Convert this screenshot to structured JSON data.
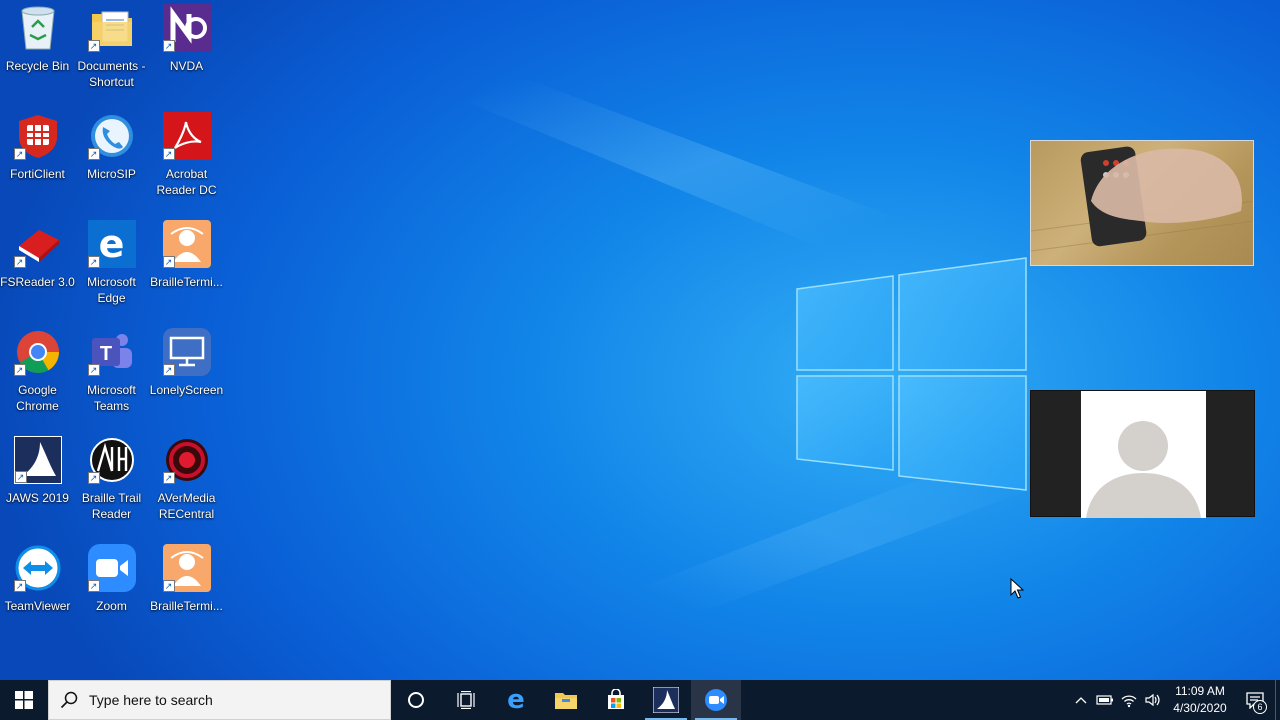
{
  "desktop": {
    "icons": [
      {
        "label": "Recycle Bin"
      },
      {
        "label": "Documents -\nShortcut"
      },
      {
        "label": "NVDA"
      },
      {
        "label": "FortiClient"
      },
      {
        "label": "MicroSIP"
      },
      {
        "label": "Acrobat\nReader DC"
      },
      {
        "label": "FSReader 3.0"
      },
      {
        "label": "Microsoft\nEdge"
      },
      {
        "label": "BrailleTermi..."
      },
      {
        "label": "Google\nChrome"
      },
      {
        "label": "Microsoft\nTeams"
      },
      {
        "label": "LonelyScreen"
      },
      {
        "label": "JAWS 2019"
      },
      {
        "label": "Braille Trail\nReader"
      },
      {
        "label": "AVerMedia\nRECentral"
      },
      {
        "label": "TeamViewer"
      },
      {
        "label": "Zoom"
      },
      {
        "label": "BrailleTermi..."
      }
    ]
  },
  "taskbar": {
    "search_placeholder": "Type here to search",
    "pinned": [
      {
        "name": "cortana-icon"
      },
      {
        "name": "task-view-icon"
      },
      {
        "name": "edge-icon"
      },
      {
        "name": "file-explorer-icon"
      },
      {
        "name": "store-icon"
      },
      {
        "name": "jaws-icon"
      },
      {
        "name": "zoom-icon"
      }
    ],
    "tray": {
      "time": "11:09 AM",
      "date": "4/30/2020",
      "notification_count": "6"
    }
  },
  "colors": {
    "taskbar": "#0c1a2e",
    "accent": "#76b9ed",
    "desktop": "#1184e8"
  }
}
